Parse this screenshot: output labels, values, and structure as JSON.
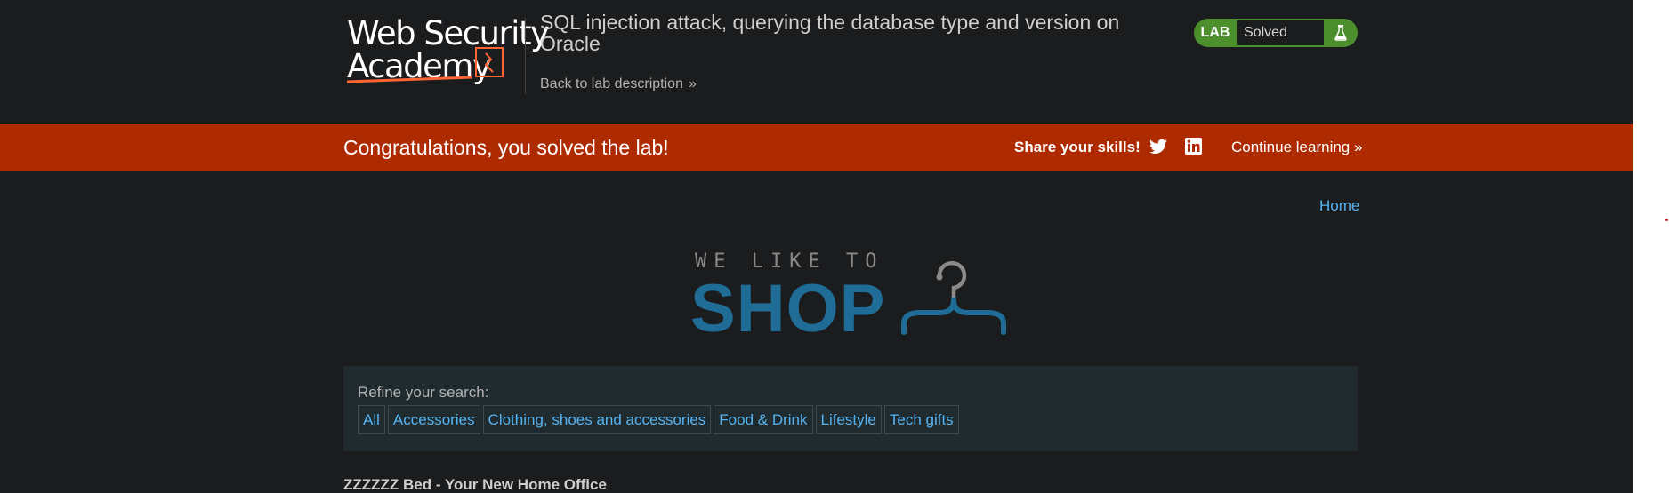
{
  "header": {
    "logo_line1": "Web Security",
    "logo_line2": "Academy",
    "lab_title": "SQL injection attack, querying the database type and version on Oracle",
    "back_link": "Back to lab description",
    "badge": {
      "label": "LAB",
      "status": "Solved"
    }
  },
  "banner": {
    "message": "Congratulations, you solved the lab!",
    "share_label": "Share your skills!",
    "continue_label": "Continue learning"
  },
  "nav": {
    "home": "Home"
  },
  "shop_logo": {
    "tagline": "WE LIKE TO",
    "word": "SHOP"
  },
  "filter": {
    "label": "Refine your search:",
    "categories": [
      "All",
      "Accessories",
      "Clothing, shoes and accessories",
      "Food & Drink",
      "Lifestyle",
      "Tech gifts"
    ]
  },
  "product": {
    "title": "ZZZZZZ Bed - Your New Home Office"
  },
  "colors": {
    "background": "#1b1c1e",
    "banner": "#ae2a00",
    "link": "#56b3f2",
    "badge_green": "#4d8f2d",
    "brand_orange": "#ff6633",
    "shop_blue": "#1f6d96"
  },
  "icons": [
    "flask-icon",
    "twitter-icon",
    "linkedin-icon",
    "double-chevron-icon",
    "hanger-icon"
  ]
}
